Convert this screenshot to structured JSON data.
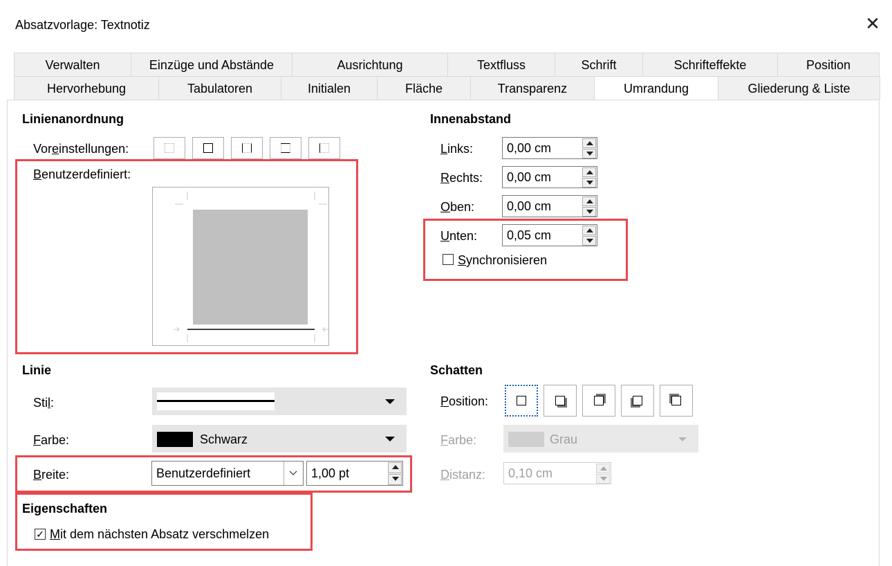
{
  "window": {
    "title": "Absatzvorlage: Textnotiz",
    "close_glyph": "✕"
  },
  "tabs_row1": [
    "Verwalten",
    "Einzüge und Abstände",
    "Ausrichtung",
    "Textfluss",
    "Schrift",
    "Schrifteffekte",
    "Position"
  ],
  "tabs_row2": [
    "Hervorhebung",
    "Tabulatoren",
    "Initialen",
    "Fläche",
    "Transparenz",
    "Umrandung",
    "Gliederung & Liste"
  ],
  "active_tab": "Umrandung",
  "linienanordnung": {
    "heading": "Linienanordnung",
    "presets_label_a": "Vor",
    "presets_label_u": "e",
    "presets_label_b": "instellungen:",
    "custom_label_u": "B",
    "custom_label_rest": "enutzerdefiniert:"
  },
  "innenabstand": {
    "heading": "Innenabstand",
    "links": {
      "label_u": "L",
      "label_rest": "inks:",
      "value": "0,00 cm"
    },
    "rechts": {
      "label_u": "R",
      "label_rest": "echts:",
      "value": "0,00 cm"
    },
    "oben": {
      "label_u": "O",
      "label_rest": "ben:",
      "value": "0,00 cm"
    },
    "unten": {
      "label_u": "U",
      "label_rest": "nten:",
      "value": "0,05 cm"
    },
    "sync": {
      "label_u": "S",
      "label_rest": "ynchronisieren",
      "checked": false
    }
  },
  "linie": {
    "heading": "Linie",
    "stil_label_a": "Sti",
    "stil_label_u": "l",
    "stil_label_b": ":",
    "farbe_label_u": "F",
    "farbe_label_rest": "arbe:",
    "farbe_value": "Schwarz",
    "farbe_color": "#000000",
    "breite_label_u": "B",
    "breite_label_rest": "reite:",
    "breite_value": "Benutzerdefiniert",
    "breite_pt": "1,00 pt"
  },
  "schatten": {
    "heading": "Schatten",
    "position_label_u": "P",
    "position_label_rest": "osition:",
    "farbe_label_u": "F",
    "farbe_label_rest": "arbe:",
    "farbe_value": "Grau",
    "distanz_label_u": "D",
    "distanz_label_rest": "istanz:",
    "distanz_value": "0,10 cm"
  },
  "eigenschaften": {
    "heading": "Eigenschaften",
    "merge_label_u": "M",
    "merge_label_rest": "it dem nächsten Absatz verschmelzen",
    "merge_checked": true,
    "check_glyph": "✓"
  },
  "colors": {
    "highlight": "#e8494f",
    "preview_fill": "#c0c0c0",
    "disabled_text": "#a0a0a0"
  }
}
